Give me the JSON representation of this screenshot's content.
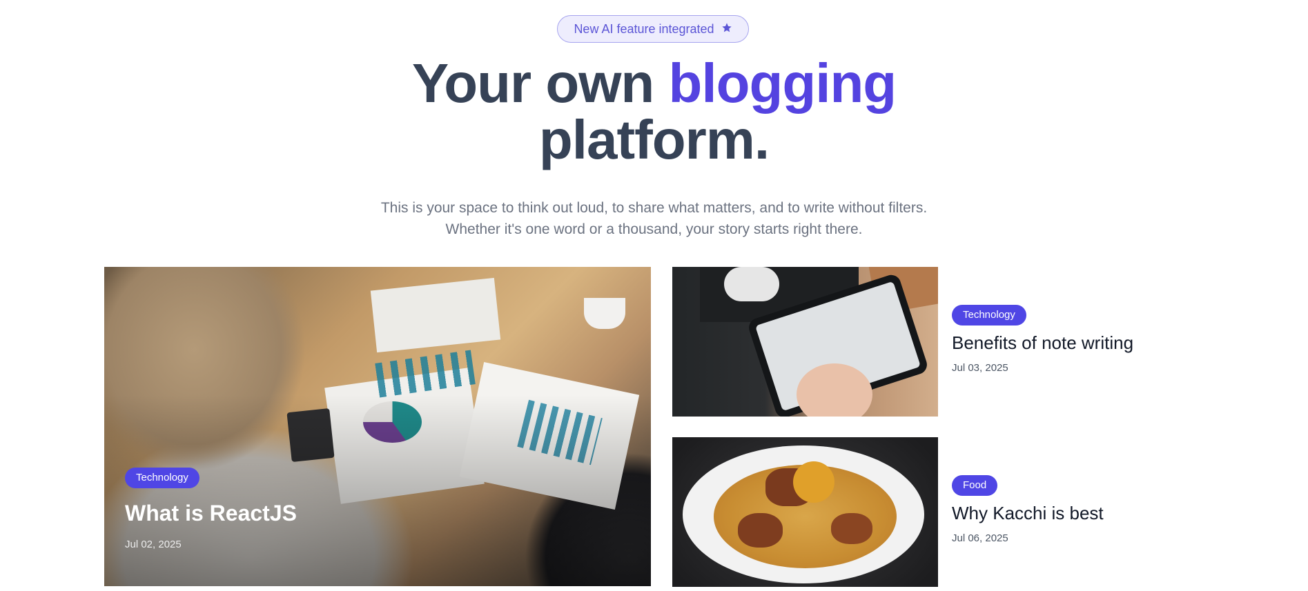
{
  "announcement": {
    "label": "New AI feature integrated",
    "icon": "star-icon",
    "color": "#5b55d6"
  },
  "hero": {
    "title_part1": "Your own ",
    "title_accent": "blogging",
    "title_part2": "platform.",
    "accent_color": "#5443e0",
    "subtitle_line1": "This is your space to think out loud, to share what matters, and to write without filters.",
    "subtitle_line2": "Whether it's one word or a thousand, your story starts right there."
  },
  "posts": {
    "featured": {
      "category": "Technology",
      "title": "What is ReactJS",
      "date": "Jul 02, 2025",
      "image": "office-charts-meeting"
    },
    "side": [
      {
        "category": "Technology",
        "title": "Benefits of note writing",
        "date": "Jul 03, 2025",
        "image": "tablet-sketch"
      },
      {
        "category": "Food",
        "title": "Why Kacchi is best",
        "date": "Jul 06, 2025",
        "image": "kacchi-biryani-plate"
      }
    ]
  },
  "colors": {
    "tag_background": "#4f46e5",
    "headline": "#364256"
  }
}
